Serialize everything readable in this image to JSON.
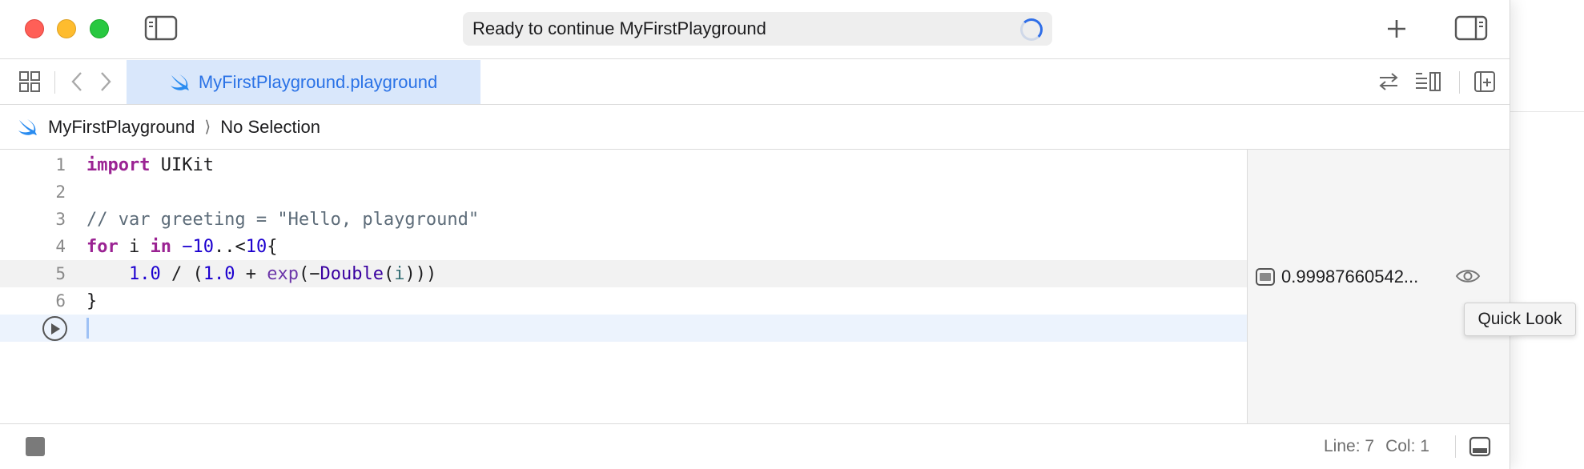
{
  "titlebar": {
    "activity_text": "Ready to continue MyFirstPlayground"
  },
  "tabbar": {
    "active_tab": "MyFirstPlayground.playground"
  },
  "jumpbar": {
    "project": "MyFirstPlayground",
    "selection": "No Selection"
  },
  "editor": {
    "line_numbers": [
      "1",
      "2",
      "3",
      "4",
      "5",
      "6"
    ],
    "lines": [
      "import UIKit",
      "",
      "// var greeting = \"Hello, playground\"",
      "for i in −10..<10{",
      "    1.0 / (1.0 + exp(−Double(i)))",
      "}"
    ],
    "tokens": {
      "import_kw": "import",
      "uikit": " UIKit",
      "comment": "// var greeting = \"Hello, playground\"",
      "for_kw": "for",
      "i1": " i ",
      "in_kw": "in",
      "space": " ",
      "neg10": "−10",
      "range": "..<",
      "pos10": "10",
      "brace_open": "{",
      "indent": "    ",
      "one1": "1.0",
      "div": " / (",
      "one2": "1.0",
      "plus": " + ",
      "exp": "exp",
      "paren_neg": "(−",
      "double": "Double",
      "paren": "(",
      "ivar": "i",
      "close": ")))",
      "brace_close": "}"
    }
  },
  "results": {
    "value": "0.99987660542..."
  },
  "tooltip": {
    "text": "Quick Look"
  },
  "statusbar": {
    "line": "Line: 7",
    "col": "Col: 1"
  },
  "colors": {
    "keyword": "#9b2393",
    "comment": "#5d6c79",
    "number": "#1c00cf",
    "accent": "#2a72e6",
    "tab_bg": "#d9e7fb"
  }
}
